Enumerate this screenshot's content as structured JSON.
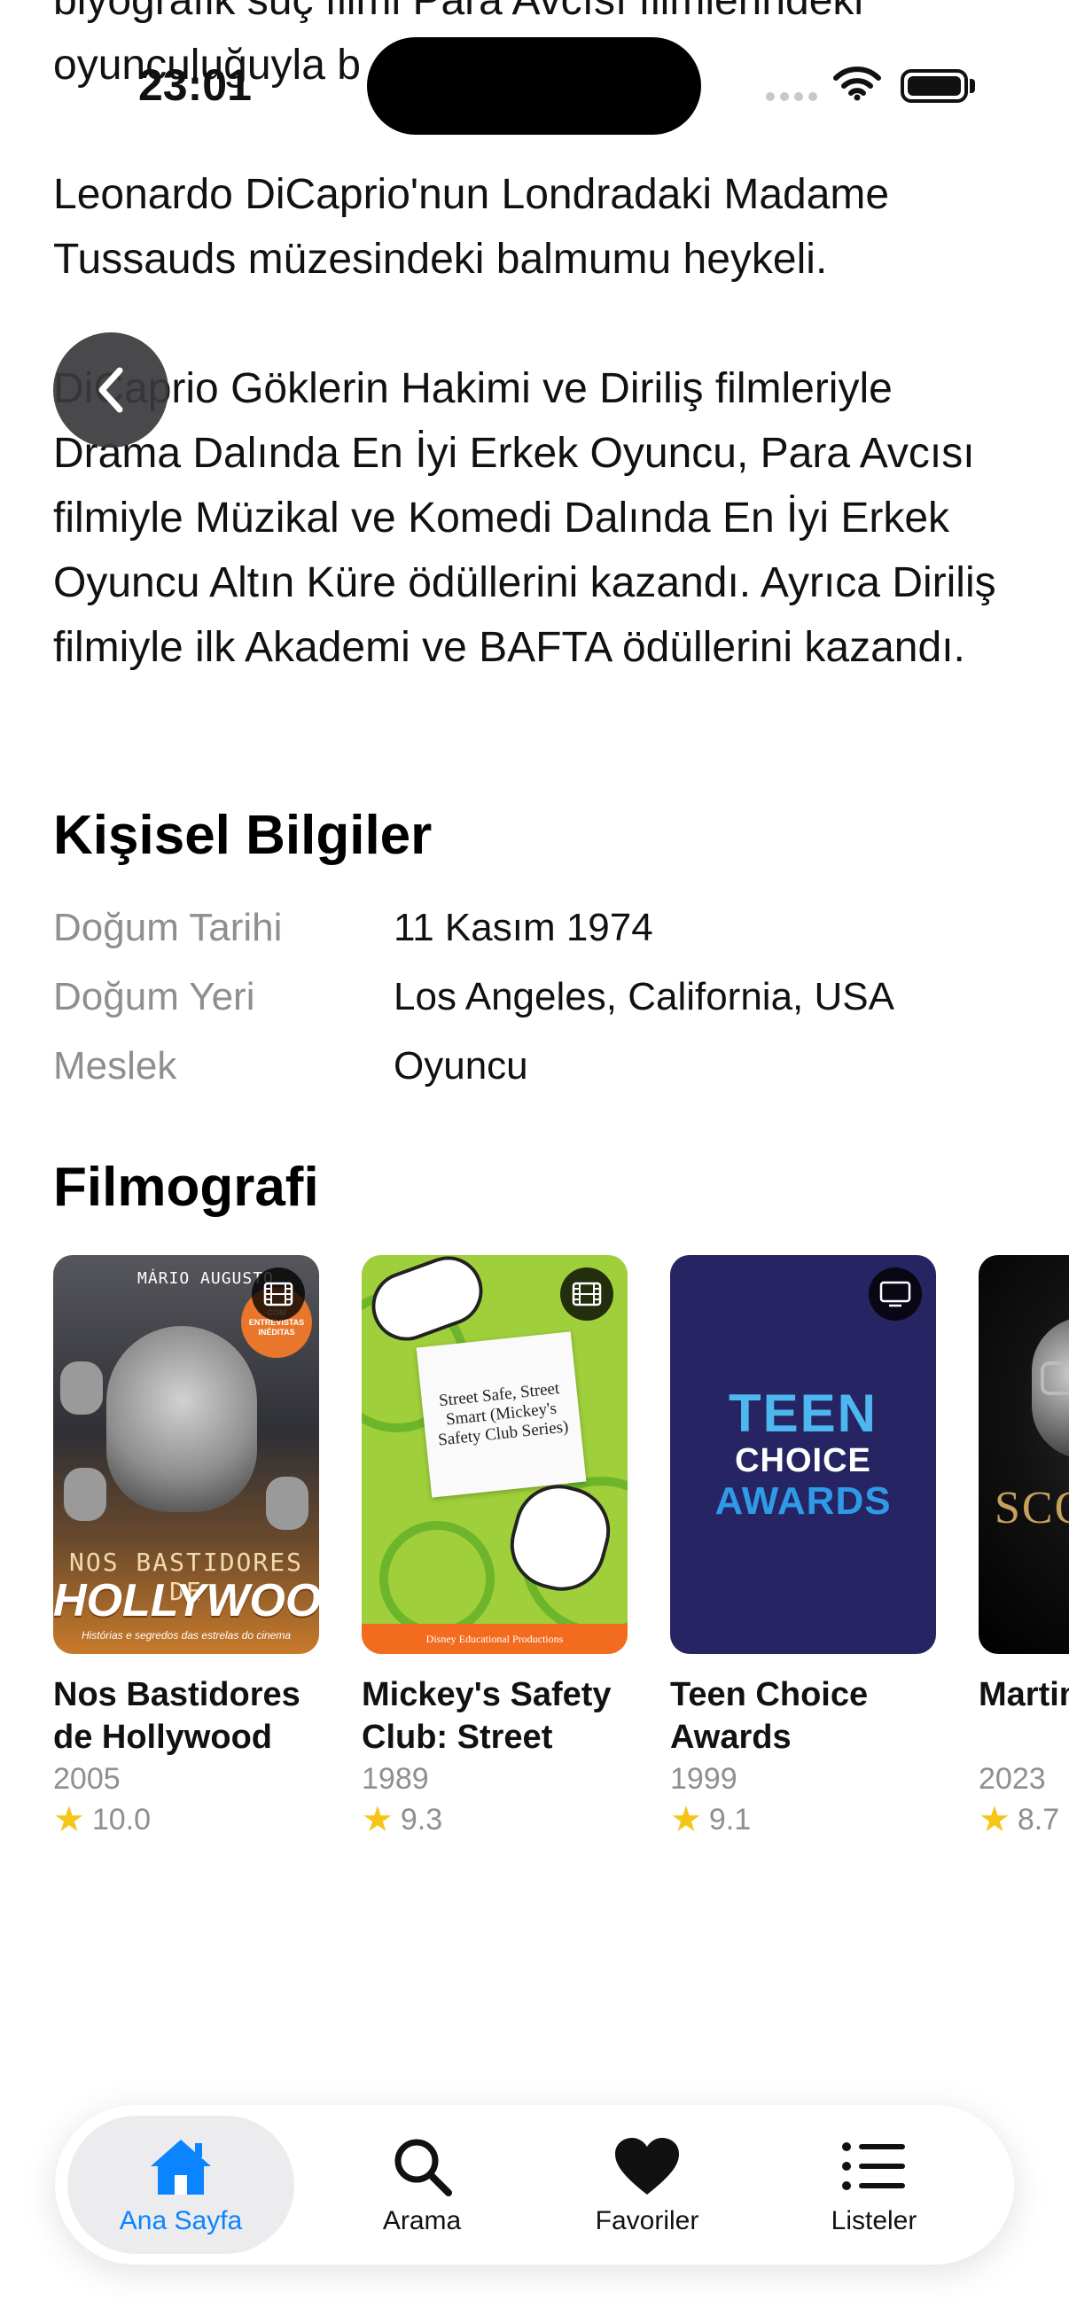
{
  "status_bar": {
    "time": "23:01"
  },
  "biography": {
    "partial_line_1": "biyografik suç filmi Para Avcısı filmlerindeki",
    "partial_line_2": "oyunculuğuyla b",
    "paragraph_2": "Leonardo DiCaprio'nun Londradaki Madame Tussauds müzesindeki balmumu heykeli.",
    "paragraph_3": "DiCaprio Göklerin Hakimi ve Diriliş filmleriyle Drama Dalında En İyi Erkek Oyuncu, Para Avcısı filmiyle Müzikal ve Komedi Dalında En İyi Erkek Oyuncu Altın Küre ödüllerini kazandı. Ayrıca Diriliş filmiyle ilk Akademi ve BAFTA ödüllerini kazandı."
  },
  "personal_info": {
    "title": "Kişisel Bilgiler",
    "rows": [
      {
        "label": "Doğum Tarihi",
        "value": "11 Kasım 1974"
      },
      {
        "label": "Doğum Yeri",
        "value": "Los Angeles, California, USA"
      },
      {
        "label": "Meslek",
        "value": "Oyuncu"
      }
    ]
  },
  "filmography": {
    "title": "Filmografi",
    "items": [
      {
        "title": "Nos Bastidores de Hollywood",
        "year": "2005",
        "rating": "10.0",
        "media_icon": "film-icon",
        "poster": {
          "author": "MÁRIO AUGUSTO",
          "badge": "COM ENTREVISTAS INÉDITAS",
          "line1": "NOS BASTIDORES DE",
          "line2": "HOLLYWOOD",
          "sub": "Histórias e segredos das estrelas do cinema"
        }
      },
      {
        "title": "Mickey's Safety Club: Street Sa...",
        "year": "1989",
        "rating": "9.3",
        "media_icon": "film-icon",
        "poster": {
          "paper_text": "Street Safe, Street Smart (Mickey's Safety Club Series)",
          "footer": "Disney Educational Productions"
        }
      },
      {
        "title": "Teen Choice Awards",
        "year": "1999",
        "rating": "9.1",
        "media_icon": "tv-icon",
        "poster": {
          "line1": "TEEN",
          "line2": "CHOICE",
          "line3": "AWARDS"
        }
      },
      {
        "title": "Martin l'Italo",
        "year": "2023",
        "rating": "8.7",
        "media_icon": "",
        "poster": {
          "text": "SCO"
        }
      }
    ]
  },
  "tab_bar": {
    "tabs": [
      {
        "label": "Ana Sayfa",
        "icon": "house-icon",
        "active": true
      },
      {
        "label": "Arama",
        "icon": "search-icon",
        "active": false
      },
      {
        "label": "Favoriler",
        "icon": "heart-icon",
        "active": false
      },
      {
        "label": "Listeler",
        "icon": "list-icon",
        "active": false
      }
    ]
  },
  "colors": {
    "accent": "#0a84ff",
    "secondary_text": "#8e8e93",
    "star": "#f5c518"
  }
}
